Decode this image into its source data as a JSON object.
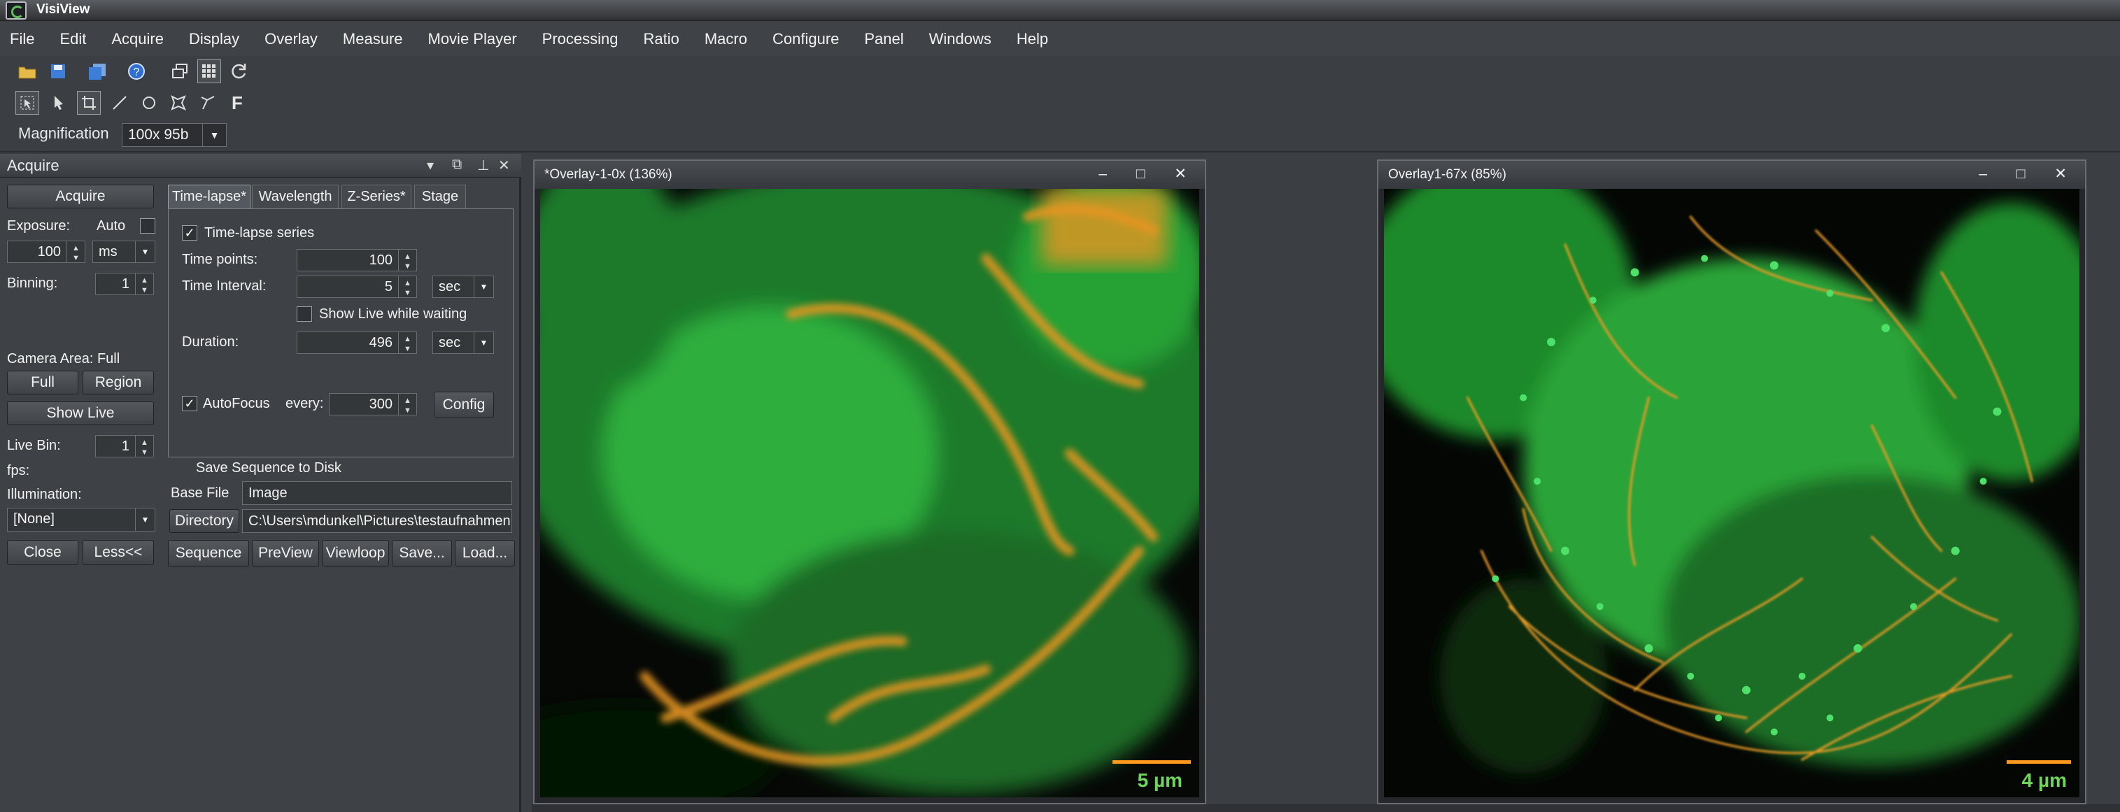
{
  "app": {
    "title": "VisiView"
  },
  "menu": [
    "File",
    "Edit",
    "Acquire",
    "Display",
    "Overlay",
    "Measure",
    "Movie Player",
    "Processing",
    "Ratio",
    "Macro",
    "Configure",
    "Panel",
    "Windows",
    "Help"
  ],
  "toolbar": {
    "row1": [
      "open-folder-icon",
      "save-icon",
      "save-all-icon",
      "help-icon",
      "windows-icon",
      "grid-icon",
      "refresh-icon"
    ],
    "row2": [
      "select-tool-icon",
      "arrow-pointer-icon",
      "crop-icon",
      "line-tool-icon",
      "ellipse-tool-icon",
      "polygon-tool-icon",
      "freehand-tool-icon",
      "text-tool-icon"
    ],
    "text_tool": "F"
  },
  "magnification": {
    "label": "Magnification",
    "value": "100x 95b"
  },
  "acquire_panel": {
    "title": "Acquire",
    "acquire_button": "Acquire",
    "exposure_label": "Exposure:",
    "auto_label": "Auto",
    "exposure_value": "100",
    "exposure_unit": "ms",
    "binning_label": "Binning:",
    "binning_value": "1",
    "camera_area_label": "Camera Area: Full",
    "full_button": "Full",
    "region_button": "Region",
    "show_live_button": "Show Live",
    "live_bin_label": "Live Bin:",
    "live_bin_value": "1",
    "fps_label": "fps:",
    "illumination_label": "Illumination:",
    "illumination_value": "[None]",
    "close_button": "Close",
    "less_button": "Less<<"
  },
  "tabs": [
    {
      "label": "Time-lapse*",
      "active": true
    },
    {
      "label": "Wavelength",
      "active": false
    },
    {
      "label": "Z-Series*",
      "active": false
    },
    {
      "label": "Stage",
      "active": false
    }
  ],
  "timelapse": {
    "series_label": "Time-lapse series",
    "series_checked": true,
    "time_points_label": "Time points:",
    "time_points_value": "100",
    "interval_label": "Time Interval:",
    "interval_value": "5",
    "interval_unit": "sec",
    "show_live_label": "Show Live while waiting",
    "show_live_checked": false,
    "duration_label": "Duration:",
    "duration_value": "496",
    "duration_unit": "sec",
    "autofocus_label": "AutoFocus",
    "autofocus_checked": true,
    "every_label": "every:",
    "every_value": "300",
    "config_button": "Config"
  },
  "save": {
    "label": "Save Sequence to Disk",
    "base_file_label": "Base File",
    "base_file_value": "Image",
    "directory_button": "Directory",
    "directory_value": "C:\\Users\\mdunkel\\Pictures\\testaufnahmen",
    "buttons": [
      "Sequence",
      "PreView",
      "Viewloop",
      "Save...",
      "Load..."
    ]
  },
  "windows": [
    {
      "title": "*Overlay-1-0x (136%)",
      "scale_label": "5 µm"
    },
    {
      "title": "Overlay1-67x (85%)",
      "scale_label": "4 µm"
    }
  ],
  "window_controls": "– □ ✕",
  "colors": {
    "green_channel": "#3fbf4a",
    "orange_channel": "#ff9a1f",
    "scale_text": "#6ed65a"
  }
}
